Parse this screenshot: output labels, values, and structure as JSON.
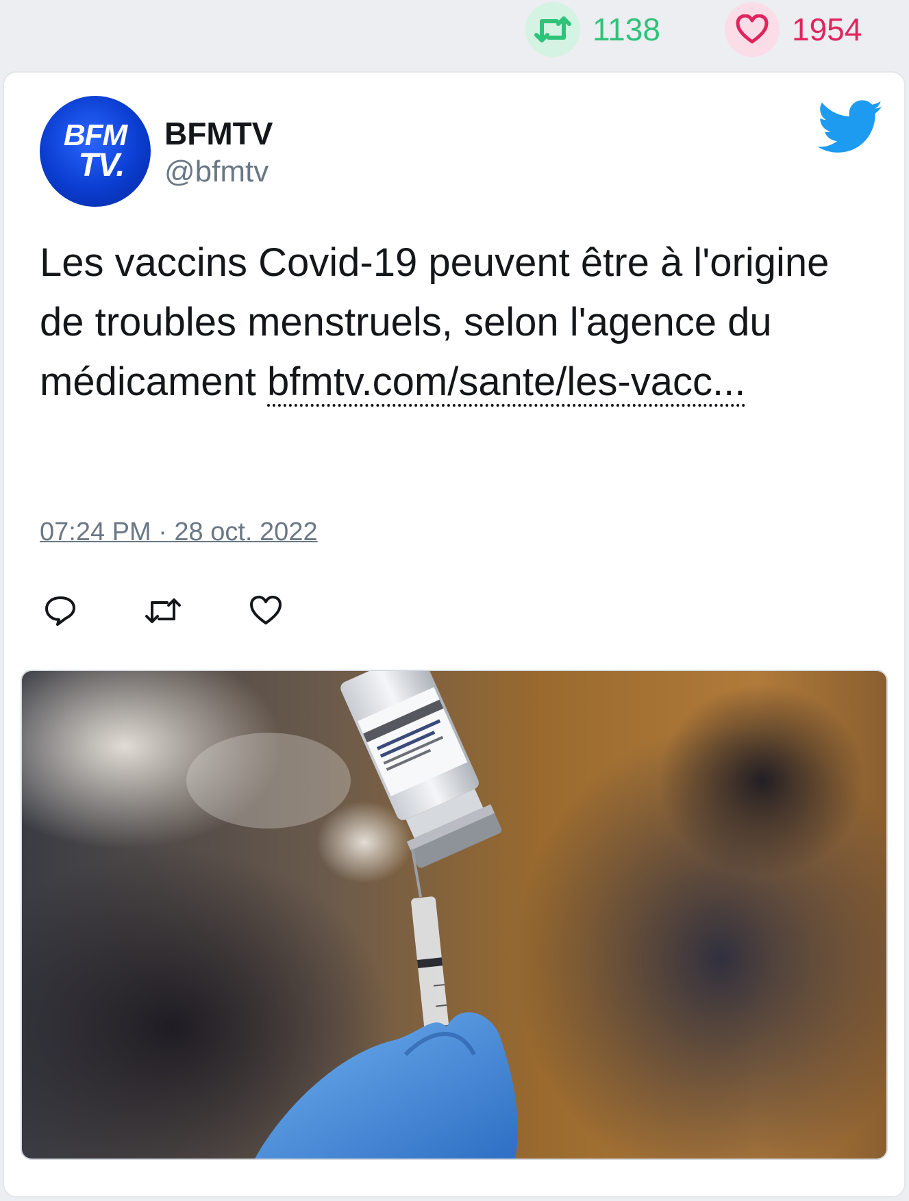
{
  "stats": {
    "retweet_count": "1138",
    "like_count": "1954",
    "retweet_icon": "retweet-icon",
    "like_icon": "heart-icon"
  },
  "tweet": {
    "author_name": "BFMTV",
    "author_handle": "@bfmtv",
    "avatar_text_line1": "BFM",
    "avatar_text_line2": "TV.",
    "text": "Les vaccins Covid-19 peuvent être à l'origine de troubles menstruels, selon l'agence du médicament ",
    "link_text": "bfmtv.com/sante/les-vacc...",
    "timestamp": "07:24 PM · 28 oct. 2022"
  },
  "actions": [
    {
      "name": "reply",
      "icon": "reply-icon"
    },
    {
      "name": "retweet",
      "icon": "retweet-icon"
    },
    {
      "name": "like",
      "icon": "heart-icon"
    }
  ],
  "colors": {
    "retweet": "#2fc27a",
    "like": "#e0245e",
    "twitter_blue": "#1d9bf0",
    "secondary_text": "#6a7785",
    "page_bg": "#eceef1"
  },
  "media": {
    "image_icon": "vaccine-photo"
  }
}
